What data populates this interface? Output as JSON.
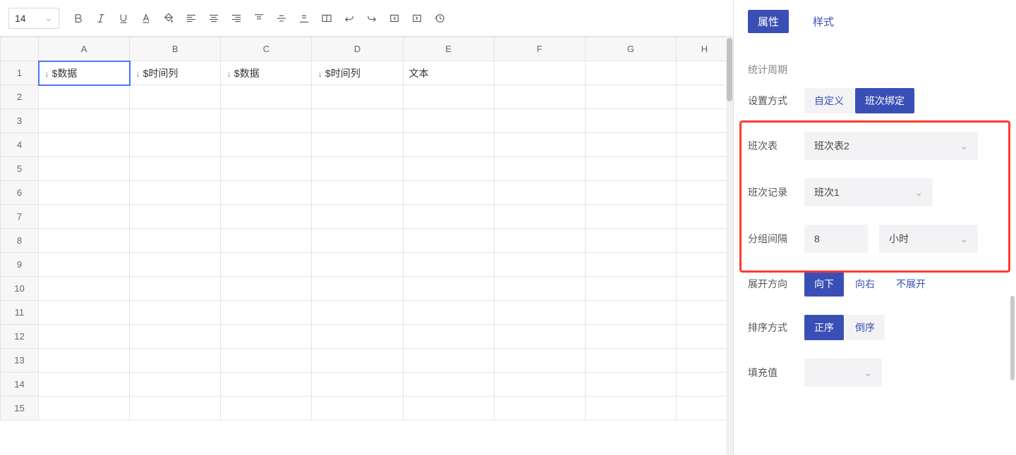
{
  "toolbar": {
    "fontSize": "14"
  },
  "sheet": {
    "columns": [
      "A",
      "B",
      "C",
      "D",
      "E",
      "F",
      "G",
      "H"
    ],
    "rowCount": 15,
    "cells": {
      "r0c0": "$数据",
      "r0c1": "$时间列",
      "r0c2": "$数据",
      "r0c3": "$时间列",
      "r0c4": "文本"
    }
  },
  "panel": {
    "tabs": {
      "attributes": "属性",
      "style": "样式"
    },
    "sectionPeriod": "统计周期",
    "labels": {
      "mode": "设置方式",
      "shiftTable": "班次表",
      "shiftRecord": "班次记录",
      "groupInterval": "分组间隔",
      "expand": "展开方向",
      "sort": "排序方式",
      "fillValue": "填充值"
    },
    "modeOptions": {
      "custom": "自定义",
      "shiftBind": "班次绑定"
    },
    "shiftTableValue": "班次表2",
    "shiftRecordValue": "班次1",
    "groupIntervalValue": "8",
    "groupIntervalUnit": "小时",
    "expandOptions": {
      "down": "向下",
      "right": "向右",
      "none": "不展开"
    },
    "sortOptions": {
      "asc": "正序",
      "desc": "倒序"
    }
  }
}
